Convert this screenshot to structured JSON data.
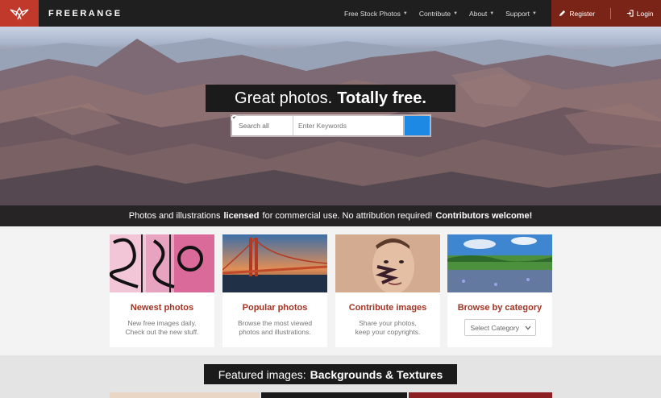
{
  "header": {
    "brand": "FREERANGE",
    "logo_icon": "freerange-bird-logo",
    "nav": [
      {
        "label": "Free Stock Photos",
        "has_caret": true
      },
      {
        "label": "Contribute",
        "has_caret": true
      },
      {
        "label": "About",
        "has_caret": true
      },
      {
        "label": "Support",
        "has_caret": true
      }
    ],
    "register": {
      "label": "Register",
      "icon": "pencil-icon"
    },
    "login": {
      "label": "Login",
      "icon": "sign-in-icon"
    }
  },
  "hero": {
    "headline_light": "Great photos.",
    "headline_bold": "Totally free.",
    "search_scope": "Search all",
    "search_placeholder": "Enter Keywords",
    "tagline": {
      "part1": "Photos and illustrations",
      "bold1": "licensed",
      "part2": "for commercial use. No attribution required!",
      "bold2": "Contributors welcome!"
    }
  },
  "cards": [
    {
      "title": "Newest photos",
      "desc_line1": "New free images daily.",
      "desc_line2": "Check out the new stuff."
    },
    {
      "title": "Popular photos",
      "desc_line1": "Browse the most viewed",
      "desc_line2": "photos and illustrations."
    },
    {
      "title": "Contribute images",
      "desc_line1": "Share your photos,",
      "desc_line2": "keep your copyrights."
    },
    {
      "title": "Browse by category",
      "select_label": "Select Category"
    }
  ],
  "featured": {
    "prefix": "Featured images:",
    "bold": "Backgrounds & Textures"
  },
  "colors": {
    "brand_red": "#c0392b",
    "auth_bg": "#7a2418",
    "card_title": "#a33322",
    "search_button": "#1e88e5"
  }
}
